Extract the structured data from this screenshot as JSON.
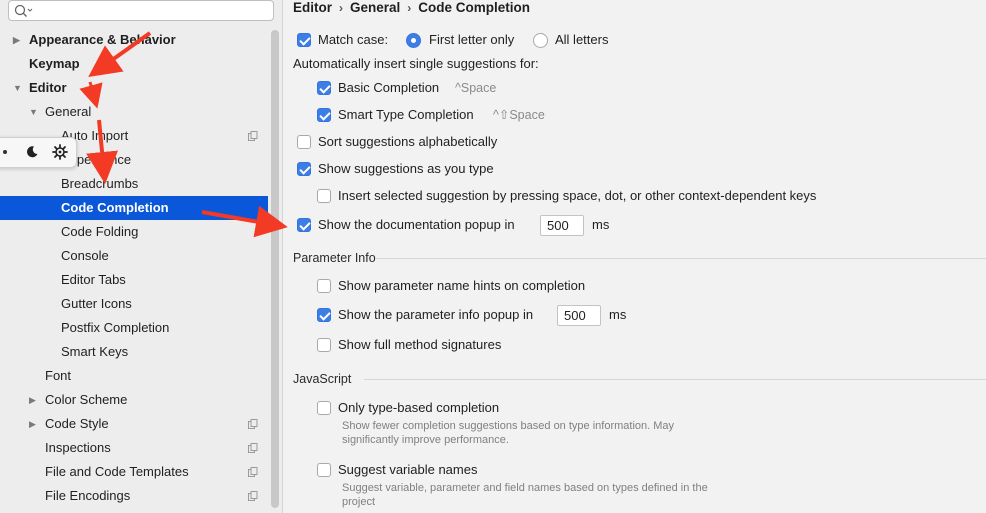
{
  "sidebar": {
    "search": {
      "placeholder": ""
    },
    "items": [
      {
        "label": "Appearance & Behavior",
        "level": 0,
        "arrow": "▶",
        "bold": true
      },
      {
        "label": "Keymap",
        "level": 0,
        "arrow": "",
        "bold": true
      },
      {
        "label": "Editor",
        "level": 0,
        "arrow": "▼",
        "bold": true
      },
      {
        "label": "General",
        "level": 1,
        "arrow": "▼",
        "bold": false
      },
      {
        "label": "Auto Import",
        "level": 2,
        "arrow": "",
        "copy": true
      },
      {
        "label": "Appearance",
        "level": 2,
        "arrow": ""
      },
      {
        "label": "Breadcrumbs",
        "level": 2,
        "arrow": ""
      },
      {
        "label": "Code Completion",
        "level": 2,
        "arrow": "",
        "selected": true
      },
      {
        "label": "Code Folding",
        "level": 2,
        "arrow": ""
      },
      {
        "label": "Console",
        "level": 2,
        "arrow": ""
      },
      {
        "label": "Editor Tabs",
        "level": 2,
        "arrow": ""
      },
      {
        "label": "Gutter Icons",
        "level": 2,
        "arrow": ""
      },
      {
        "label": "Postfix Completion",
        "level": 2,
        "arrow": ""
      },
      {
        "label": "Smart Keys",
        "level": 2,
        "arrow": ""
      },
      {
        "label": "Font",
        "level": 1,
        "arrow": ""
      },
      {
        "label": "Color Scheme",
        "level": 1,
        "arrow": "▶"
      },
      {
        "label": "Code Style",
        "level": 1,
        "arrow": "▶",
        "copy": true
      },
      {
        "label": "Inspections",
        "level": 1,
        "arrow": "",
        "copy": true
      },
      {
        "label": "File and Code Templates",
        "level": 1,
        "arrow": "",
        "copy": true
      },
      {
        "label": "File Encodings",
        "level": 1,
        "arrow": "",
        "copy": true
      }
    ]
  },
  "breadcrumb": {
    "parts": [
      "Editor",
      "General",
      "Code Completion"
    ],
    "separator": "›"
  },
  "completion": {
    "match_case_label": "Match case:",
    "match_case_checked": true,
    "radio_first_letter": "First letter only",
    "radio_all_letters": "All letters",
    "auto_insert_title": "Automatically insert single suggestions for:",
    "basic_completion": {
      "label": "Basic Completion",
      "shortcut": "^Space",
      "checked": true
    },
    "smart_type_completion": {
      "label": "Smart Type Completion",
      "shortcut": "^⇧Space",
      "checked": true
    },
    "sort_alpha": {
      "label": "Sort suggestions alphabetically",
      "checked": false
    },
    "show_as_you_type": {
      "label": "Show suggestions as you type",
      "checked": true
    },
    "insert_selected": {
      "label": "Insert selected suggestion by pressing space, dot, or other context-dependent keys",
      "checked": false
    },
    "doc_popup": {
      "label": "Show the documentation popup in",
      "value": "500",
      "unit": "ms",
      "checked": true
    }
  },
  "parameter_info": {
    "title": "Parameter Info",
    "name_hints": {
      "label": "Show parameter name hints on completion",
      "checked": false
    },
    "info_popup": {
      "label": "Show the parameter info popup in",
      "value": "500",
      "unit": "ms",
      "checked": true
    },
    "full_signatures": {
      "label": "Show full method signatures",
      "checked": false
    }
  },
  "javascript": {
    "title": "JavaScript",
    "type_based": {
      "label": "Only type-based completion",
      "help": "Show fewer completion suggestions based on type information. May significantly improve performance.",
      "checked": false
    },
    "variable_names": {
      "label": "Suggest variable names",
      "help": "Suggest variable, parameter and field names based on types defined in the project",
      "checked": false
    }
  },
  "colors": {
    "selection": "#0b57d9",
    "checkbox_on": "#3d7ee6",
    "annotation_arrow": "#f23a24"
  },
  "icons": {
    "search": "search-icon",
    "toolbar": [
      "dot-icon",
      "moon-icon",
      "gear-icon"
    ],
    "copy": "copy-icon"
  }
}
